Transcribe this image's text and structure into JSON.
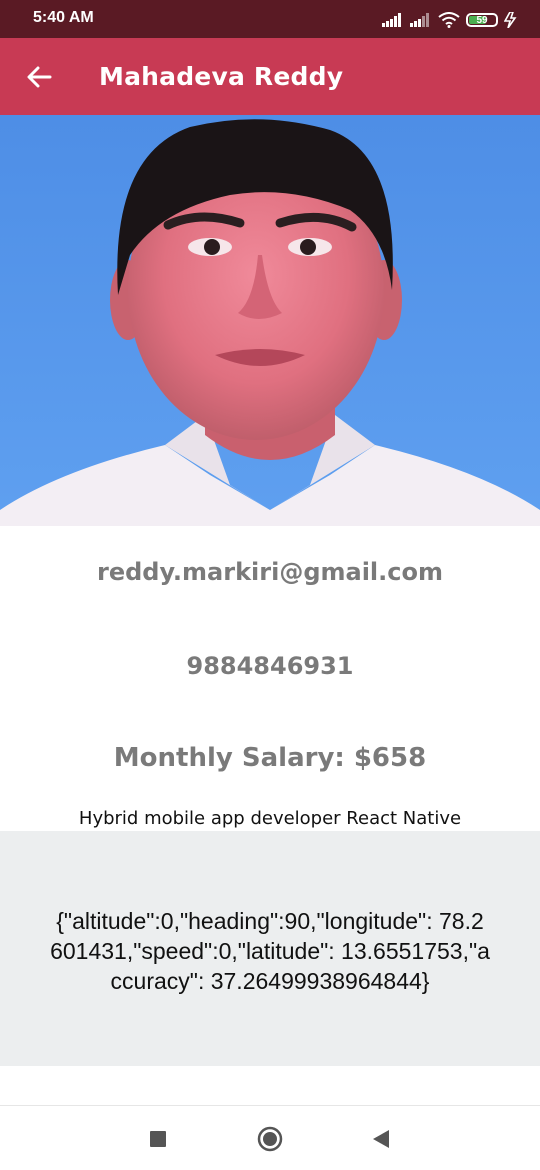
{
  "status_bar": {
    "time": "5:40 AM",
    "battery_level": "59"
  },
  "app_bar": {
    "title": "Mahadeva Reddy",
    "background_color": "#c83a54"
  },
  "profile": {
    "email": "reddy.markiri@gmail.com",
    "phone": "9884846931",
    "salary": "Monthly Salary: $658",
    "bio": "Hybrid mobile app developer React Native"
  },
  "location": {
    "json_text": "{\"altitude\":0,\"heading\":90,\"longitude\": 78.2601431,\"speed\":0,\"latitude\": 13.6551753,\"accuracy\": 37.26499938964844}"
  },
  "icons": {
    "back": "arrow-left-icon",
    "signal": "signal-bars-icon",
    "wifi": "wifi-icon",
    "battery": "battery-icon",
    "charging": "charging-icon",
    "nav_recents": "square-icon",
    "nav_home": "circle-icon",
    "nav_back": "triangle-left-icon"
  }
}
